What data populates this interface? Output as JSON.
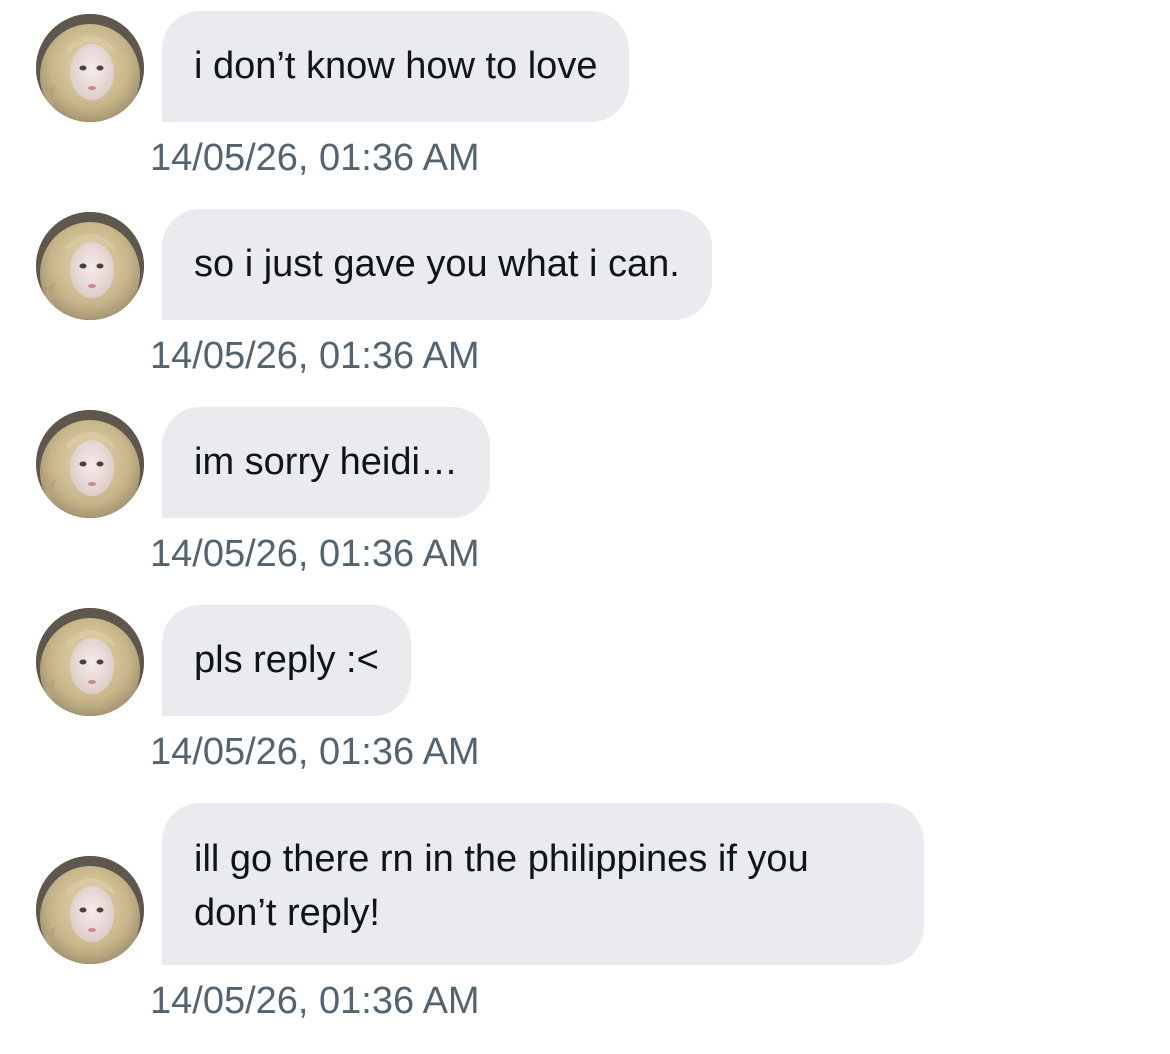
{
  "conversation": {
    "messages": [
      {
        "text": "i don’t know how to love",
        "timestamp": "14/05/26, 01:36 AM",
        "avatar": "profile-photo"
      },
      {
        "text": "so i just gave you what i can.",
        "timestamp": "14/05/26, 01:36 AM",
        "avatar": "profile-photo"
      },
      {
        "text": "im sorry heidi…",
        "timestamp": "14/05/26, 01:36 AM",
        "avatar": "profile-photo"
      },
      {
        "text": "pls reply :<",
        "timestamp": "14/05/26, 01:36 AM",
        "avatar": "profile-photo"
      },
      {
        "text": "ill go there rn in the philippines if you don’t reply!",
        "timestamp": "14/05/26, 01:36 AM",
        "avatar": "profile-photo"
      }
    ]
  },
  "colors": {
    "bubble_bg": "#eaebee",
    "message_text": "#0f1419",
    "timestamp_text": "#536471",
    "background": "#ffffff"
  }
}
